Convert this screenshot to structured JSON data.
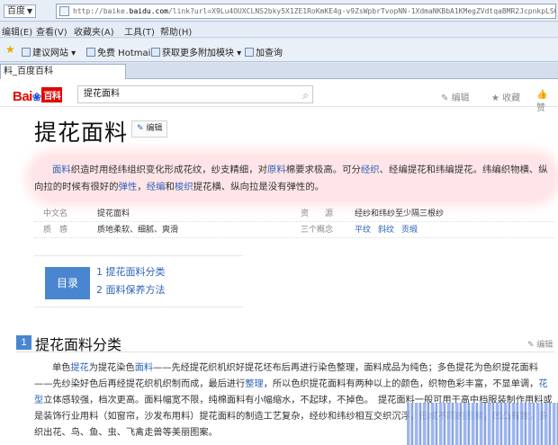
{
  "browser": {
    "engine_label": "百度",
    "url_prefix": "http://baike.",
    "url_domain": "baidu.com",
    "url_rest": "/link?url=X9Lu4OUXCLNS2bky5X1ZE1RoKmKE4g-v9ZsWpbrTvopNN-1XdmaNKBbA1KMegZVdtqaBMR2JcpnkpLSQLmi8K",
    "menu": [
      "编辑(E)",
      "查看(V)",
      "收藏夹(A)",
      "工具(T)",
      "帮助(H)"
    ],
    "favorites": [
      "建议网站 ▾",
      "免费 Hotmail",
      "获取更多附加模块 ▾",
      "加查询"
    ],
    "tab_title": "料_百度百科"
  },
  "baike": {
    "logo_text": "Bai",
    "logo_paw": "❀",
    "logo_tag": "百科",
    "search_value": "提花面料",
    "actions": [
      "编辑",
      "收藏",
      "赞"
    ]
  },
  "article": {
    "title": "提花面料",
    "edit_label": "编辑",
    "summary": [
      {
        "t": "面料",
        "link": true
      },
      {
        "t": "织造时用经纬组织变化形成花纹，纱支精细，对",
        "link": false
      },
      {
        "t": "原料",
        "link": true
      },
      {
        "t": "棉要求极高。可分",
        "link": false
      },
      {
        "t": "经织",
        "link": true
      },
      {
        "t": "、经编提花和纬编提花。纬编织物横、纵向拉的时候有很好的",
        "link": false
      },
      {
        "t": "弹性",
        "link": true
      },
      {
        "t": "，",
        "link": false
      },
      {
        "t": "经编",
        "link": true
      },
      {
        "t": "和",
        "link": false
      },
      {
        "t": "梭织",
        "link": true
      },
      {
        "t": "提花横、纵向拉是没有弹性的。",
        "link": false
      }
    ],
    "info_rows": [
      {
        "k1": "中文名",
        "v1": "提花面料",
        "k2": "资　　源",
        "v2": "经纱和纬纱至少隔三根纱",
        "v2_links": []
      },
      {
        "k1": "质　感",
        "v1": "质地柔软、细腻、爽滑",
        "k2": "三个概念",
        "v2": "",
        "v2_links": [
          "平纹",
          "斜纹",
          "贡缎"
        ]
      }
    ],
    "toc": {
      "label": "目录",
      "items": [
        "1 提花面料分类",
        "2 面料保养方法"
      ]
    },
    "section": {
      "num": "1",
      "title": "提花面料分类",
      "edit_label": "编辑",
      "body": [
        {
          "t": "单色",
          "link": false
        },
        {
          "t": "提花",
          "link": true
        },
        {
          "t": "为提花染色",
          "link": false
        },
        {
          "t": "面料",
          "link": true
        },
        {
          "t": "——先经提花织机织好提花坯布后再进行染色整理，面料成品为纯色；多色提花为色织提花面料——先纱染好色后再经提花织机织制而成，最后进行",
          "link": false
        },
        {
          "t": "整理",
          "link": true
        },
        {
          "t": "，所以色织提花面料有两种以上的颜色，织物色彩丰富，不显单调，",
          "link": false
        },
        {
          "t": "花型",
          "link": true
        },
        {
          "t": "立体感较强，档次更高。面料幅宽不限，纯棉面料有小幅缩水，不起球，不掉色。　提花面料一般可用于高中档服装制作用料或是装饰行业用料（如窗帘，沙发布用料）提花面料的制造工艺复杂，经纱和纬纱相互交织沉浮，形成不同的",
          "link": false
        },
        {
          "t": "图案",
          "link": true
        },
        {
          "t": "，凹凸有致，多织出花、鸟、鱼、虫、飞禽走兽等美丽图案。",
          "link": false
        }
      ]
    }
  }
}
